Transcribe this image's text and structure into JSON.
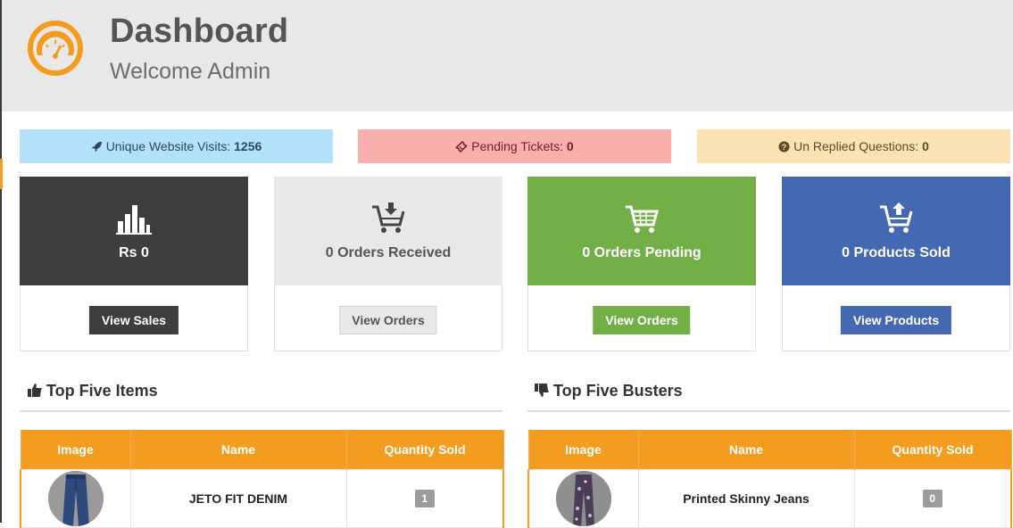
{
  "header": {
    "title": "Dashboard",
    "subtitle": "Welcome Admin",
    "logo_icon": "speedometer-icon",
    "accent_color": "#f39c1f"
  },
  "alerts": {
    "visits": {
      "label": "Unique Website Visits:",
      "value": "1256",
      "icon": "rocket-icon"
    },
    "tickets": {
      "label": "Pending Tickets:",
      "value": "0",
      "icon": "ticket-icon"
    },
    "questions": {
      "label": "Un Replied Questions:",
      "value": "0",
      "icon": "question-circle-icon"
    }
  },
  "cards": [
    {
      "value": "Rs 0",
      "button": "View Sales",
      "icon": "bar-chart-icon",
      "color": "#3e3e3e"
    },
    {
      "value": "0 Orders Received",
      "button": "View Orders",
      "icon": "cart-download-icon",
      "color": "#e8e8e8"
    },
    {
      "value": "0 Orders Pending",
      "button": "View Orders",
      "icon": "cart-icon",
      "color": "#72af47"
    },
    {
      "value": "0 Products Sold",
      "button": "View Products",
      "icon": "cart-upload-icon",
      "color": "#4569b0"
    }
  ],
  "top_items": {
    "title": "Top Five Items",
    "icon": "thumbs-up-icon",
    "columns": [
      "Image",
      "Name",
      "Quantity Sold"
    ],
    "rows": [
      {
        "name": "JETO FIT DENIM",
        "quantity": "1"
      }
    ]
  },
  "top_busters": {
    "title": "Top Five Busters",
    "icon": "thumbs-down-icon",
    "columns": [
      "Image",
      "Name",
      "Quantity Sold"
    ],
    "rows": [
      {
        "name": "Printed Skinny Jeans",
        "quantity": "0"
      }
    ]
  }
}
